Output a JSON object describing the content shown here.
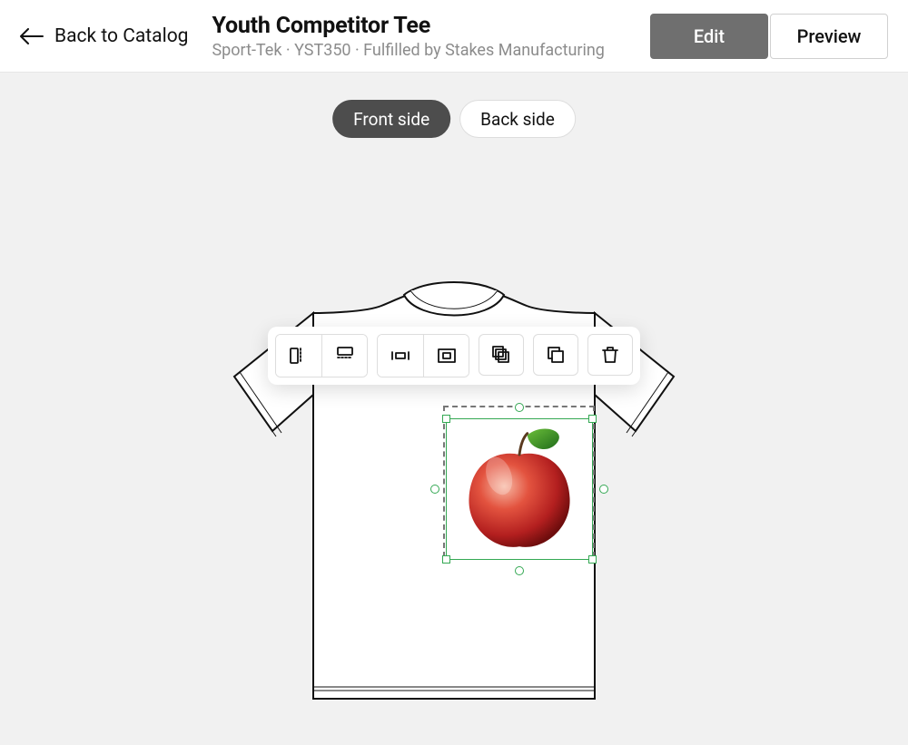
{
  "header": {
    "back_label": "Back to Catalog",
    "title": "Youth Competitor Tee",
    "subtitle": "Sport-Tek · YST350 · Fulfilled by Stakes Manufacturing",
    "edit_label": "Edit",
    "preview_label": "Preview"
  },
  "sides": {
    "front_label": "Front side",
    "back_label": "Back side",
    "active": "front"
  },
  "toolbar": {
    "items": [
      {
        "name": "align-horizontal-center",
        "group": 0
      },
      {
        "name": "align-vertical-center",
        "group": 0
      },
      {
        "name": "fit-horizontal",
        "group": 1
      },
      {
        "name": "fit-to-area",
        "group": 1
      },
      {
        "name": "duplicate-layer",
        "group": null
      },
      {
        "name": "copy",
        "group": null
      },
      {
        "name": "delete",
        "group": null
      }
    ]
  },
  "design": {
    "object": "apple-image",
    "selected": true
  }
}
